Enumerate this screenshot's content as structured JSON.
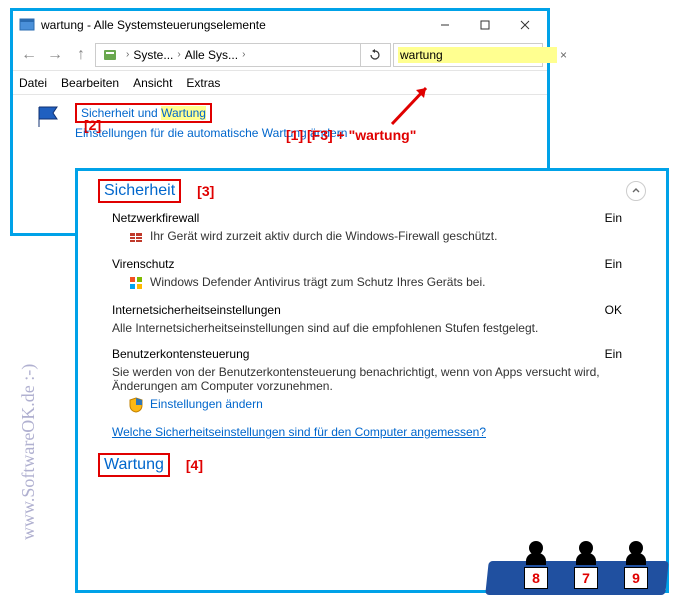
{
  "window1": {
    "title": "wartung - Alle Systemsteuerungselemente",
    "breadcrumb": {
      "part1": "Syste...",
      "part2": "Alle Sys...",
      "sep": "›"
    },
    "search_value": "wartung",
    "menu": {
      "file": "Datei",
      "edit": "Bearbeiten",
      "view": "Ansicht",
      "extras": "Extras"
    },
    "result": {
      "title_a": "Sicherheit und ",
      "title_b": "Wartung",
      "sub1": "Einstellungen für die automatische Wartung ändern"
    }
  },
  "window2": {
    "sections": {
      "security": {
        "title": "Sicherheit",
        "items": {
          "firewall": {
            "name": "Netzwerkfirewall",
            "status": "Ein",
            "desc": "Ihr Gerät wird zurzeit aktiv durch die Windows-Firewall geschützt."
          },
          "antivirus": {
            "name": "Virenschutz",
            "status": "Ein",
            "desc": "Windows Defender Antivirus trägt zum Schutz Ihres Geräts bei."
          },
          "internet": {
            "name": "Internetsicherheitseinstellungen",
            "status": "OK",
            "desc": "Alle Internetsicherheitseinstellungen sind auf die empfohlenen Stufen festgelegt."
          },
          "uac": {
            "name": "Benutzerkontensteuerung",
            "status": "Ein",
            "desc": "Sie werden von der Benutzerkontensteuerung benachrichtigt, wenn von Apps versucht wird, Änderungen am Computer vorzunehmen.",
            "link": "Einstellungen ändern"
          }
        },
        "footer_link": "Welche Sicherheitseinstellungen sind für den Computer angemessen?"
      },
      "maintenance": {
        "title": "Wartung"
      }
    }
  },
  "annotations": {
    "a1": "[1]  [F3] + \"wartung\"",
    "a2": "[2]",
    "a3": "[3]",
    "a4": "[4]"
  },
  "watermark": "www.SoftwareOK.de :-)",
  "judges": [
    "8",
    "7",
    "9"
  ]
}
